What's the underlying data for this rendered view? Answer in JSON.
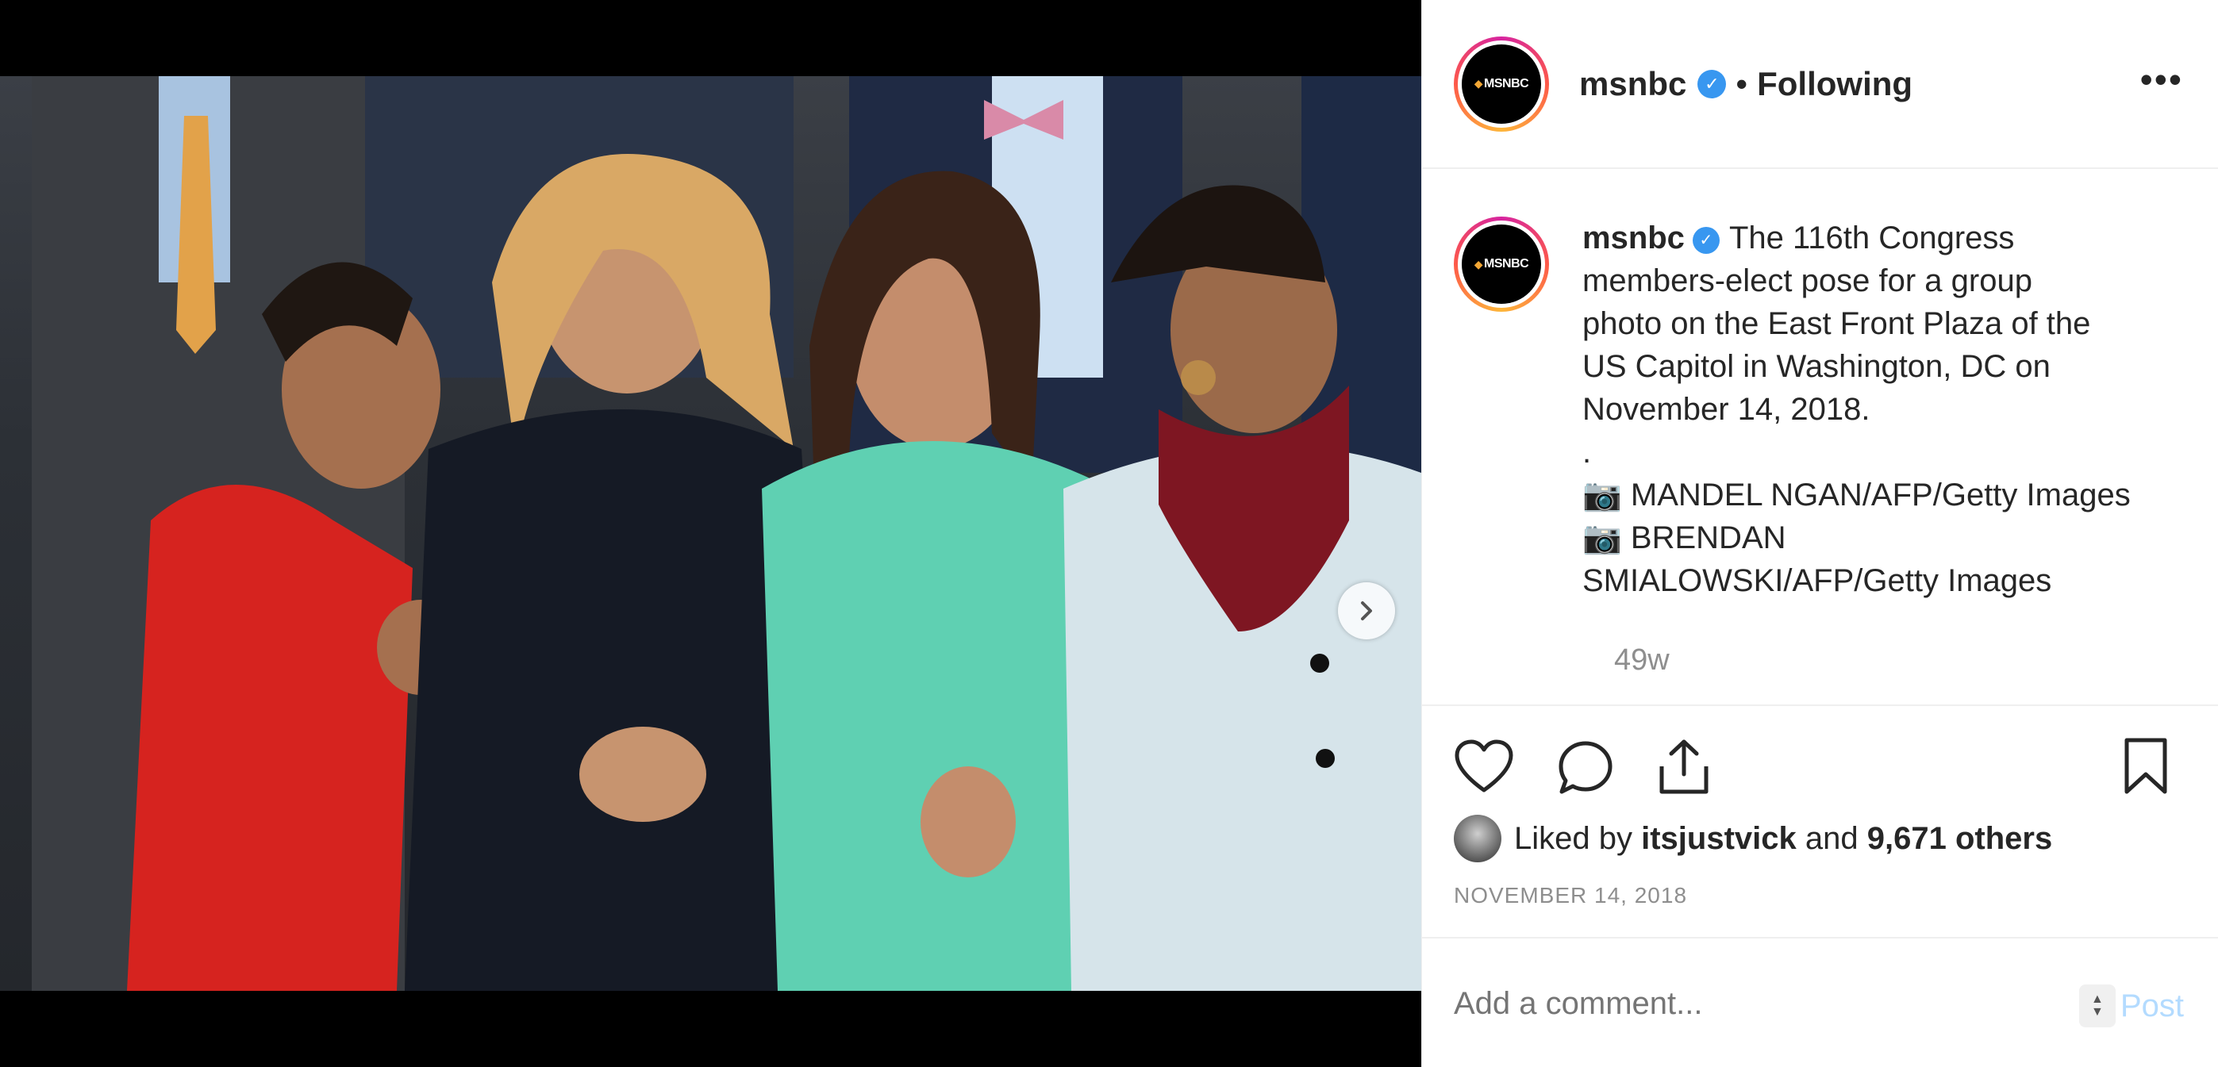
{
  "post": {
    "username": "msnbc",
    "follow_status": "Following",
    "separator": "•",
    "avatar_text": "MSNBC",
    "caption_lines": [
      "The 116th Congress",
      "members-elect pose for a group",
      "photo on the East Front Plaza of the",
      "US Capitol in Washington, DC on",
      "November 14, 2018."
    ],
    "caption_dot": ".",
    "credits": [
      "📷 MANDEL NGAN/AFP/Getty Images",
      "📷 BRENDAN",
      "SMIALOWSKI/AFP/Getty Images"
    ],
    "time_ago": "49w",
    "likes": {
      "prefix": "Liked by",
      "first_user": "itsjustvick",
      "conjunction": "and",
      "others": "9,671 others"
    },
    "date": "NOVEMBER 14, 2018",
    "comment_placeholder": "Add a comment...",
    "post_label": "Post"
  },
  "carousel": {
    "slide_count": 2,
    "active_index": 0
  },
  "icons": {
    "verified": "verified-badge-icon",
    "more": "more-options-icon",
    "like": "heart-icon",
    "comment": "comment-icon",
    "share": "share-icon",
    "save": "bookmark-icon",
    "next": "chevron-right-icon"
  },
  "colors": {
    "verified_blue": "#3897f0",
    "post_button": "#b3dbff",
    "muted_text": "#8e8e8e"
  }
}
